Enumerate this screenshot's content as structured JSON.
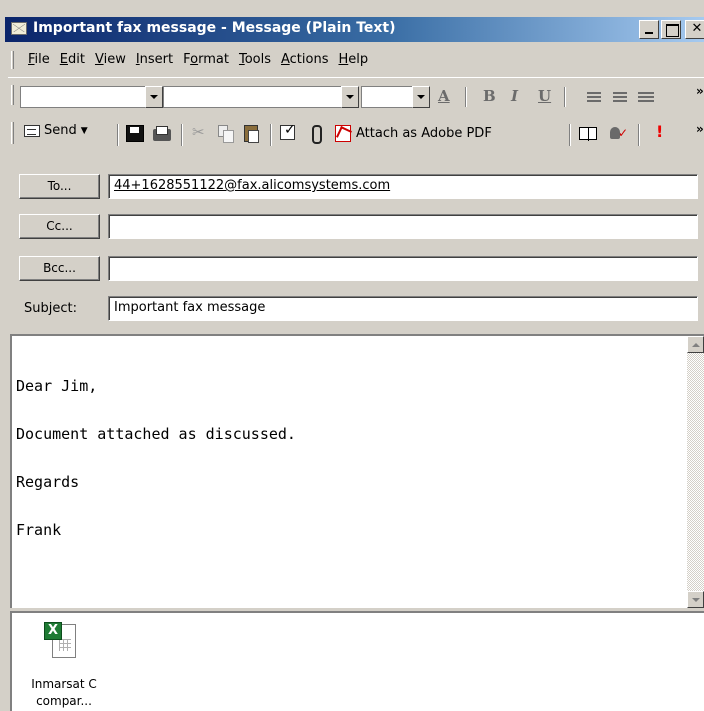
{
  "window": {
    "title": "Important fax message - Message (Plain Text)",
    "caption_buttons": [
      "minimize",
      "maximize",
      "close"
    ]
  },
  "menu": {
    "items": [
      {
        "label": "File",
        "key": "F"
      },
      {
        "label": "Edit",
        "key": "E"
      },
      {
        "label": "View",
        "key": "V"
      },
      {
        "label": "Insert",
        "key": "I"
      },
      {
        "label": "Format",
        "key": "o"
      },
      {
        "label": "Tools",
        "key": "T"
      },
      {
        "label": "Actions",
        "key": "A"
      },
      {
        "label": "Help",
        "key": "H"
      }
    ]
  },
  "format_toolbar": {
    "font_color_glyph": "A",
    "bold_glyph": "B",
    "italic_glyph": "I",
    "underline_glyph": "U",
    "overflow": "»"
  },
  "standard_toolbar": {
    "send_label": "Send",
    "attach_pdf_label": "Attach as Adobe PDF",
    "overflow": "»",
    "importance_glyph": "!"
  },
  "header": {
    "to_button": "To...",
    "cc_button": "Cc...",
    "bcc_button": "Bcc...",
    "to_value": "44+1628551122@fax.alicomsystems.com",
    "cc_value": "",
    "bcc_value": "",
    "subject_label": "Subject:",
    "subject_value": "Important fax message"
  },
  "body": {
    "lines": [
      "Dear Jim,",
      "Document attached as discussed.",
      "Regards",
      "Frank"
    ]
  },
  "attachment": {
    "icon_glyph": "X",
    "name_line1": "Inmarsat C",
    "name_line2": "compar..."
  }
}
